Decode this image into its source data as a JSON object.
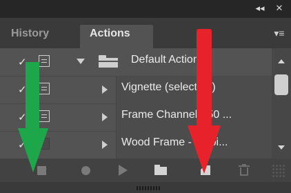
{
  "window": {
    "collapse_icon": "double-chevron-right-icon",
    "collapse_glyph": "◂◂",
    "close_glyph": "✕"
  },
  "tabs": [
    {
      "label": "History",
      "active": false
    },
    {
      "label": "Actions",
      "active": true
    }
  ],
  "panel_menu_glyph": "▾≡",
  "actions": [
    {
      "label": "Default Actions",
      "type": "set",
      "checked": true,
      "dialog": true,
      "expanded": true
    },
    {
      "label": "Vignette (selection)",
      "type": "action",
      "checked": true,
      "dialog": true
    },
    {
      "label": "Frame Channel - 50 ...",
      "type": "action",
      "checked": true,
      "dialog": true
    },
    {
      "label": "Wood Frame - 50 pi...",
      "type": "action",
      "checked": true,
      "dialog": false
    }
  ],
  "check_glyph": "✓",
  "toolbar": {
    "buttons": [
      "stop-playing-icon",
      "begin-recording-icon",
      "play-selection-icon",
      "create-new-set-icon",
      "create-new-action-icon",
      "delete-icon"
    ]
  },
  "annotations": {
    "green_arrow_color": "#1ea64a",
    "red_arrow_color": "#e8222b"
  }
}
